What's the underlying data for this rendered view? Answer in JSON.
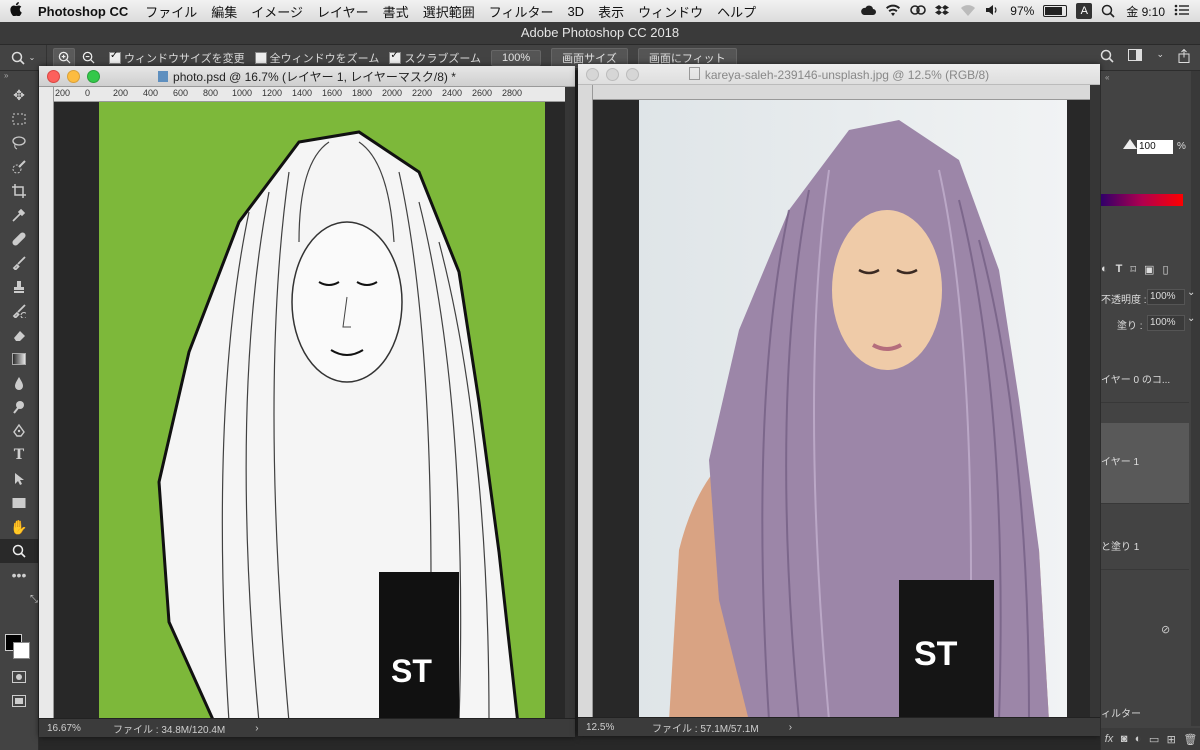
{
  "menubar": {
    "app_name": "Photoshop CC",
    "items": [
      "ファイル",
      "編集",
      "イメージ",
      "レイヤー",
      "書式",
      "選択範囲",
      "フィルター",
      "3D",
      "表示",
      "ウィンドウ",
      "ヘルプ"
    ],
    "battery": "97%",
    "input_source": "A",
    "clock": "金 9:10"
  },
  "window_title": "Adobe Photoshop CC 2018",
  "options_bar": {
    "resize_windows_label": "ウィンドウサイズを変更",
    "zoom_all_label": "全ウィンドウをズーム",
    "scrubby_zoom_label": "スクラブズーム",
    "zoom_100_label": "100%",
    "fit_screen_label": "画面サイズ",
    "fill_screen_label": "画面にフィット"
  },
  "doc_left": {
    "title": "photo.psd @ 16.7% (レイヤー 1, レイヤーマスク/8) *",
    "ruler_ticks": [
      "200",
      "0",
      "200",
      "400",
      "600",
      "800",
      "1000",
      "1200",
      "1400",
      "1600",
      "1800",
      "2000",
      "2200",
      "2400",
      "2600",
      "2800"
    ],
    "zoom": "16.67%",
    "file_info": "ファイル : 34.8M/120.4M",
    "arrow": "›",
    "canvas_color": "#7db83a"
  },
  "doc_right": {
    "title": "kareya-saleh-239146-unsplash.jpg @ 12.5% (RGB/8)",
    "zoom": "12.5%",
    "file_info": "ファイル : 57.1M/57.1M",
    "arrow": "›"
  },
  "right_panel": {
    "opacity_value": "100",
    "opacity_unit": "%",
    "layer_opacity_label": "不透明度 :",
    "layer_opacity_value": "100%",
    "fill_label": "塗り :",
    "fill_value": "100%",
    "layers": [
      "イヤー 0 のコ...",
      "イヤー 1",
      "と塗り 1"
    ],
    "filter_label": "ィルター",
    "fx_label": "fx"
  },
  "colors": {
    "accent_green": "#7db83a",
    "ui_dark": "#434343"
  }
}
